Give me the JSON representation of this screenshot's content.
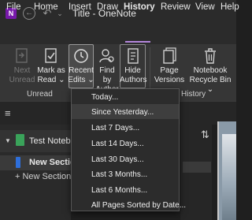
{
  "window": {
    "title": "Title - OneNote",
    "app_icon_letter": "N",
    "back_glyph": "←",
    "undo_glyph": "↶",
    "more_glyph": "⌄"
  },
  "tabs": [
    {
      "label": "File"
    },
    {
      "label": "Home"
    },
    {
      "label": "Insert"
    },
    {
      "label": "Draw"
    },
    {
      "label": "History"
    },
    {
      "label": "Review"
    },
    {
      "label": "View"
    },
    {
      "label": "Help"
    }
  ],
  "ribbon": {
    "next_unread": {
      "line1": "Next",
      "line2": "Unread"
    },
    "mark_as_read": {
      "line1": "Mark as",
      "line2": "Read ⌄"
    },
    "recent_edits": {
      "line1": "Recent",
      "line2": "Edits ⌄"
    },
    "find_by_author": {
      "line1": "Find by",
      "line2": "Author"
    },
    "hide_authors": {
      "line1": "Hide",
      "line2": "Authors"
    },
    "page_versions": {
      "line1": "Page",
      "line2": "Versions ⌄"
    },
    "notebook_recycle_bin": {
      "line1": "Notebook",
      "line2": "Recycle Bin ⌄"
    },
    "groups": {
      "unread": "Unread",
      "history": "History"
    }
  },
  "sidebar": {
    "hamburger_glyph": "≡",
    "expand_glyph": "▼",
    "notebook": "Test Noteboo",
    "section": "New Section",
    "add_section": "+  New Section"
  },
  "pages": {
    "sort_glyph": "⇅"
  },
  "recent_edits_menu": {
    "items": [
      "Today...",
      "Since Yesterday...",
      "Last 7 Days...",
      "Last 14 Days...",
      "Last 30 Days...",
      "Last 3 Months...",
      "Last 6 Months...",
      "All Pages Sorted by Date..."
    ],
    "highlighted_index": 1
  },
  "colors": {
    "accent_purple": "#b386dc",
    "notebook_green": "#3aa35a",
    "section_blue": "#2e6fdb",
    "app_purple": "#7719aa"
  }
}
